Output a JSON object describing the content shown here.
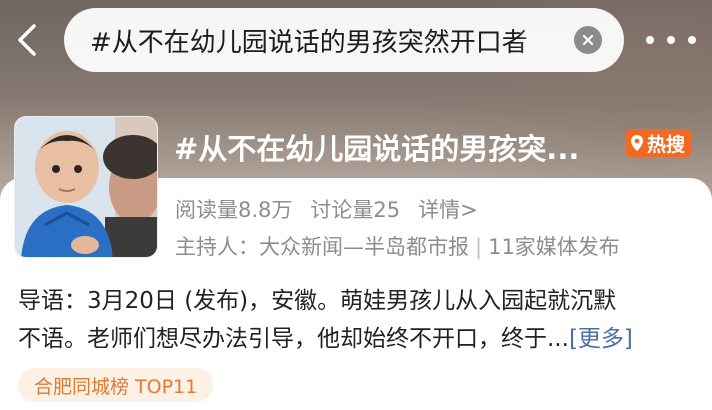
{
  "search": {
    "query": "#从不在幼儿园说话的男孩突然开口者"
  },
  "topic": {
    "title": "#从不在幼儿园说话的男孩突...",
    "hot_badge": "热搜",
    "reads": "阅读量8.8万",
    "discussions": "讨论量25",
    "details": "详情>",
    "host": "主持人：大众新闻—半岛都市报",
    "media": "11家媒体发布",
    "intro_line1": "导语：3月20日 (发布)，安徽。萌娃男孩儿从入园起就沉默",
    "intro_line2": "不语。老师们想尽办法引导，他却始终不开口，终于...",
    "more": "[更多]",
    "rank_tag": "合肥同城榜 TOP11"
  },
  "colors": {
    "hot_badge": "#f26a22",
    "link": "#4a6fa5",
    "rank_tag_text": "#e07a35",
    "rank_tag_bg": "#fdf1e6"
  },
  "icons": {
    "back": "back-arrow-icon",
    "clear": "clear-icon",
    "more": "more-dots-icon",
    "hot": "location-pin-icon"
  }
}
